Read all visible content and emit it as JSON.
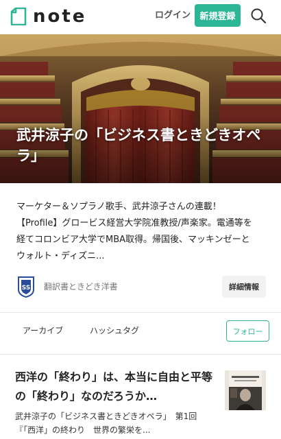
{
  "header": {
    "logo_text": "note",
    "login_label": "ログイン",
    "signup_label": "新規登録",
    "search_icon": "search-icon",
    "accent_color": "#2cb696"
  },
  "hero": {
    "title": "武井涼子の「ビジネス書ときどきオペラ」"
  },
  "description": {
    "lines": [
      "マーケター＆ソプラノ歌手、武井涼子さんの連載！",
      "【Profile】グロービス経営大学院准教授/声楽家。電通等を",
      "経てコロンビア大学でMBA取得。帰国後、マッキンゼーと",
      "ウォルト・ディズニ..."
    ]
  },
  "author": {
    "name": "翻訳書ときどき洋書",
    "details_label": "詳細情報"
  },
  "tabs": {
    "archive_label": "アーカイブ",
    "hashtag_label": "ハッシュタグ",
    "follow_label": "フォロー"
  },
  "article": {
    "title_lines": [
      "西洋の「終わり」は、本当に自由と平等",
      "の「終わり」なのだろうか…"
    ],
    "meta_line_1": "武井涼子の「ビジネス書ときどきオペラ」　第1回",
    "meta_line_2": "『「西洋」の終わり　世界の繁栄を..."
  }
}
